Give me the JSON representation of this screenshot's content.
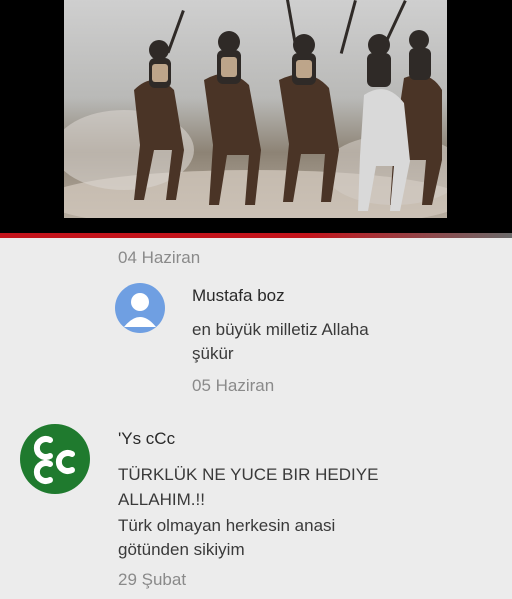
{
  "header": {
    "date": "04 Haziran"
  },
  "comments": [
    {
      "author": "Mustafa boz",
      "text_lines": [
        "en büyük milletiz Allaha",
        "şükür"
      ],
      "date": "05 Haziran",
      "avatar_icon": "default-user-icon",
      "avatar_color": "#6f9fe2"
    },
    {
      "author": "'Ys   cCc",
      "text_lines": [
        "TÜRKLÜK NE YUCE BIR HEDIYE",
        "ALLAHIM.!!",
        "Türk olmayan herkesin anasi",
        "götünden sikiyim"
      ],
      "date": "29 Şubat",
      "avatar_icon": "ccc-emblem-icon",
      "avatar_color": "#1f7a2e"
    }
  ],
  "colors": {
    "accent_line": "#c3141b",
    "background": "#ececec"
  }
}
